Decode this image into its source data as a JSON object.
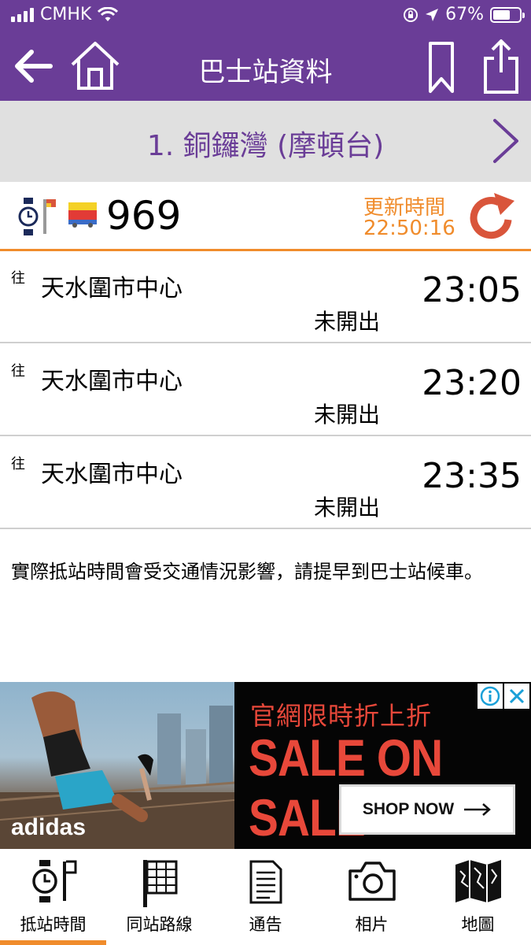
{
  "status_bar": {
    "carrier": "CMHK",
    "battery_percent": "67%",
    "battery_level": 0.67
  },
  "nav": {
    "title": "巴士站資料",
    "icons": [
      "back-arrow-icon",
      "home-icon",
      "bookmark-icon",
      "share-icon"
    ]
  },
  "stop": {
    "name": "1. 銅鑼灣 (摩頓台)"
  },
  "route": {
    "number": "969",
    "update_label": "更新時間",
    "update_time": "22:50:16"
  },
  "etas": [
    {
      "to": "往",
      "destination": "天水圍市中心",
      "time": "23:05",
      "status": "未開出"
    },
    {
      "to": "往",
      "destination": "天水圍市中心",
      "time": "23:20",
      "status": "未開出"
    },
    {
      "to": "往",
      "destination": "天水圍市中心",
      "time": "23:35",
      "status": "未開出"
    }
  ],
  "notice": "實際抵站時間會受交通情況影響，請提早到巴士站候車。",
  "ad": {
    "headline": "官網限時折上折",
    "sale_text": "SALE ON SALE",
    "button_label": "SHOP NOW",
    "brand": "adidas"
  },
  "tabs": [
    {
      "label": "抵站時間",
      "icon": "clock-flag-icon",
      "active": true
    },
    {
      "label": "同站路線",
      "icon": "route-board-icon",
      "active": false
    },
    {
      "label": "通告",
      "icon": "notice-icon",
      "active": false
    },
    {
      "label": "相片",
      "icon": "camera-icon",
      "active": false
    },
    {
      "label": "地圖",
      "icon": "map-icon",
      "active": false
    }
  ],
  "colors": {
    "primary": "#6a3d97",
    "accent": "#f08c2c",
    "refresh": "#d9553b"
  }
}
